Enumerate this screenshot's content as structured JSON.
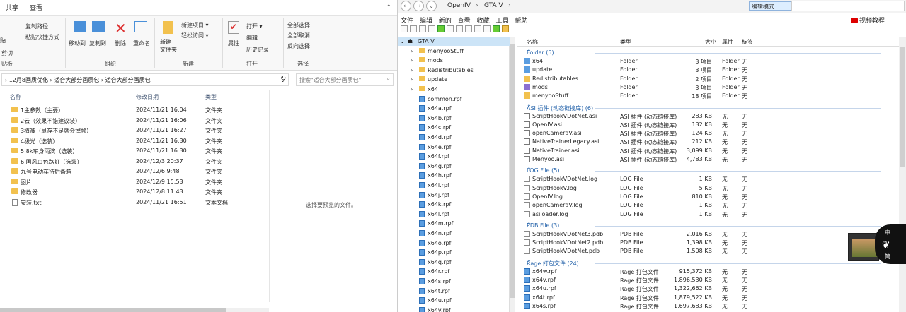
{
  "explorer": {
    "ribbon_tabs": [
      "共享",
      "查看"
    ],
    "ribbon": {
      "paste": "贴",
      "cut": "剪切",
      "copy_path": "复制路径",
      "paste_shortcut": "粘贴快捷方式",
      "clipboard_group": "贴板",
      "move_to": "移动到",
      "copy_to": "复制到",
      "delete": "删除",
      "rename": "重命名",
      "organize_group": "组织",
      "new_folder": "新建\n文件夹",
      "new_item": "新建项目 ▾",
      "easy_access": "轻松访问 ▾",
      "new_group": "新建",
      "properties": "属性",
      "open": "打开 ▾",
      "edit": "编辑",
      "history": "历史记录",
      "open_group": "打开",
      "select_all": "全部选择",
      "select_none": "全部取消",
      "invert": "反向选择",
      "select_group": "选择"
    },
    "address": "›  12月8画质优化  ›  适合大部分画质包  ›  适合大部分画质包",
    "search_placeholder": "搜索\"适合大部分画质包\"",
    "columns": {
      "name": "名称",
      "date": "修改日期",
      "type": "类型"
    },
    "files": [
      {
        "name": "1主参数（主要）",
        "date": "2024/11/21 16:04",
        "type": "文件夹",
        "kind": "folder"
      },
      {
        "name": "2云（效果不错建议装）",
        "date": "2024/11/21 16:06",
        "type": "文件夹",
        "kind": "folder"
      },
      {
        "name": "3植被（显存不足就会掉帧）",
        "date": "2024/11/21 16:27",
        "type": "文件夹",
        "kind": "folder"
      },
      {
        "name": "4极光（选装）",
        "date": "2024/11/21 16:30",
        "type": "文件夹",
        "kind": "folder"
      },
      {
        "name": "5 8k车身雨滴（选装）",
        "date": "2024/11/21 16:30",
        "type": "文件夹",
        "kind": "folder"
      },
      {
        "name": "6 国风白色路灯（选装）",
        "date": "2024/12/3 20:37",
        "type": "文件夹",
        "kind": "folder"
      },
      {
        "name": "九号电动车待后备箱",
        "date": "2024/12/6 9:48",
        "type": "文件夹",
        "kind": "folder"
      },
      {
        "name": "图片",
        "date": "2024/12/9 15:53",
        "type": "文件夹",
        "kind": "folder"
      },
      {
        "name": "修改器",
        "date": "2024/12/8 11:43",
        "type": "文件夹",
        "kind": "folder"
      },
      {
        "name": "安装.txt",
        "date": "2024/11/21 16:51",
        "type": "文本文档",
        "kind": "txt"
      }
    ],
    "preview_message": "选择要预览的文件。"
  },
  "openiv": {
    "path": [
      "OpenIV",
      "GTA V"
    ],
    "edit_mode": "编辑模式",
    "menu": [
      "文件",
      "编辑",
      "新的",
      "查看",
      "收藏",
      "工具",
      "帮助"
    ],
    "video_tutorial": "视频教程",
    "tree": [
      {
        "label": "GTA V",
        "kind": "root",
        "level": 0,
        "selected": true
      },
      {
        "label": "menyooStuff",
        "kind": "folder",
        "level": 1
      },
      {
        "label": "mods",
        "kind": "folder",
        "level": 1
      },
      {
        "label": "Redistributables",
        "kind": "folder",
        "level": 1
      },
      {
        "label": "update",
        "kind": "folder",
        "level": 1
      },
      {
        "label": "x64",
        "kind": "folder",
        "level": 1
      },
      {
        "label": "common.rpf",
        "kind": "file",
        "level": 1
      },
      {
        "label": "x64a.rpf",
        "kind": "file",
        "level": 1
      },
      {
        "label": "x64b.rpf",
        "kind": "file",
        "level": 1
      },
      {
        "label": "x64c.rpf",
        "kind": "file",
        "level": 1
      },
      {
        "label": "x64d.rpf",
        "kind": "file",
        "level": 1
      },
      {
        "label": "x64e.rpf",
        "kind": "file",
        "level": 1
      },
      {
        "label": "x64f.rpf",
        "kind": "file",
        "level": 1
      },
      {
        "label": "x64g.rpf",
        "kind": "file",
        "level": 1
      },
      {
        "label": "x64h.rpf",
        "kind": "file",
        "level": 1
      },
      {
        "label": "x64i.rpf",
        "kind": "file",
        "level": 1
      },
      {
        "label": "x64j.rpf",
        "kind": "file",
        "level": 1
      },
      {
        "label": "x64k.rpf",
        "kind": "file",
        "level": 1
      },
      {
        "label": "x64l.rpf",
        "kind": "file",
        "level": 1
      },
      {
        "label": "x64m.rpf",
        "kind": "file",
        "level": 1
      },
      {
        "label": "x64n.rpf",
        "kind": "file",
        "level": 1
      },
      {
        "label": "x64o.rpf",
        "kind": "file",
        "level": 1
      },
      {
        "label": "x64p.rpf",
        "kind": "file",
        "level": 1
      },
      {
        "label": "x64q.rpf",
        "kind": "file",
        "level": 1
      },
      {
        "label": "x64r.rpf",
        "kind": "file",
        "level": 1
      },
      {
        "label": "x64s.rpf",
        "kind": "file",
        "level": 1
      },
      {
        "label": "x64t.rpf",
        "kind": "file",
        "level": 1
      },
      {
        "label": "x64u.rpf",
        "kind": "file",
        "level": 1
      },
      {
        "label": "x64v.rpf",
        "kind": "file",
        "level": 1
      }
    ],
    "columns": {
      "name": "名称",
      "type": "类型",
      "size": "大小",
      "attr": "属性",
      "tag": "标签"
    },
    "groups": [
      {
        "title": "Folder (5)",
        "icon": "folder",
        "items": [
          {
            "name": "x64",
            "type": "Folder",
            "size": "3 项目",
            "attr": "Folder",
            "tag": "无",
            "icon": "folder-blue"
          },
          {
            "name": "update",
            "type": "Folder",
            "size": "3 项目",
            "attr": "Folder",
            "tag": "无",
            "icon": "folder-blue"
          },
          {
            "name": "Redistributables",
            "type": "Folder",
            "size": "2 项目",
            "attr": "Folder",
            "tag": "无",
            "icon": "folder"
          },
          {
            "name": "mods",
            "type": "Folder",
            "size": "3 项目",
            "attr": "Folder",
            "tag": "无",
            "icon": "folder-purple"
          },
          {
            "name": "menyooStuff",
            "type": "Folder",
            "size": "18 项目",
            "attr": "Folder",
            "tag": "无",
            "icon": "folder"
          }
        ]
      },
      {
        "title": "ASI 插件 (动态链接库) (6)",
        "icon": "asi",
        "items": [
          {
            "name": "ScriptHookVDotNet.asi",
            "type": "ASI 插件 (动态链接库)",
            "size": "283 KB",
            "attr": "无",
            "tag": "无",
            "icon": "asi"
          },
          {
            "name": "OpenIV.asi",
            "type": "ASI 插件 (动态链接库)",
            "size": "132 KB",
            "attr": "无",
            "tag": "无",
            "icon": "asi"
          },
          {
            "name": "openCameraV.asi",
            "type": "ASI 插件 (动态链接库)",
            "size": "124 KB",
            "attr": "无",
            "tag": "无",
            "icon": "asi"
          },
          {
            "name": "NativeTrainerLegacy.asi",
            "type": "ASI 插件 (动态链接库)",
            "size": "212 KB",
            "attr": "无",
            "tag": "无",
            "icon": "asi"
          },
          {
            "name": "NativeTrainer.asi",
            "type": "ASI 插件 (动态链接库)",
            "size": "3,099 KB",
            "attr": "无",
            "tag": "无",
            "icon": "asi"
          },
          {
            "name": "Menyoo.asi",
            "type": "ASI 插件 (动态链接库)",
            "size": "4,783 KB",
            "attr": "无",
            "tag": "无",
            "icon": "asi"
          }
        ]
      },
      {
        "title": "LOG File (5)",
        "icon": "log",
        "items": [
          {
            "name": "ScriptHookVDotNet.log",
            "type": "LOG File",
            "size": "1 KB",
            "attr": "无",
            "tag": "无",
            "icon": "log"
          },
          {
            "name": "ScriptHookV.log",
            "type": "LOG File",
            "size": "5 KB",
            "attr": "无",
            "tag": "无",
            "icon": "log"
          },
          {
            "name": "OpenIV.log",
            "type": "LOG File",
            "size": "810 KB",
            "attr": "无",
            "tag": "无",
            "icon": "log"
          },
          {
            "name": "openCameraV.log",
            "type": "LOG File",
            "size": "1 KB",
            "attr": "无",
            "tag": "无",
            "icon": "log"
          },
          {
            "name": "asiloader.log",
            "type": "LOG File",
            "size": "1 KB",
            "attr": "无",
            "tag": "无",
            "icon": "log"
          }
        ]
      },
      {
        "title": "PDB File (3)",
        "icon": "pdb",
        "items": [
          {
            "name": "ScriptHookVDotNet3.pdb",
            "type": "PDB File",
            "size": "2,016 KB",
            "attr": "无",
            "tag": "无",
            "icon": "pdb"
          },
          {
            "name": "ScriptHookVDotNet2.pdb",
            "type": "PDB File",
            "size": "1,398 KB",
            "attr": "无",
            "tag": "无",
            "icon": "pdb"
          },
          {
            "name": "ScriptHookVDotNet.pdb",
            "type": "PDB File",
            "size": "1,508 KB",
            "attr": "无",
            "tag": "无",
            "icon": "pdb"
          }
        ]
      },
      {
        "title": "Rage 打包文件 (24)",
        "icon": "rpf",
        "items": [
          {
            "name": "x64w.rpf",
            "type": "Rage 打包文件",
            "size": "915,372 KB",
            "attr": "无",
            "tag": "无",
            "icon": "rpf"
          },
          {
            "name": "x64v.rpf",
            "type": "Rage 打包文件",
            "size": "1,896,530 KB",
            "attr": "无",
            "tag": "无",
            "icon": "rpf"
          },
          {
            "name": "x64u.rpf",
            "type": "Rage 打包文件",
            "size": "1,322,662 KB",
            "attr": "无",
            "tag": "无",
            "icon": "rpf"
          },
          {
            "name": "x64t.rpf",
            "type": "Rage 打包文件",
            "size": "1,879,522 KB",
            "attr": "无",
            "tag": "无",
            "icon": "rpf"
          },
          {
            "name": "x64s.rpf",
            "type": "Rage 打包文件",
            "size": "1,697,683 KB",
            "attr": "无",
            "tag": "无",
            "icon": "rpf"
          }
        ]
      }
    ]
  },
  "overlay": {
    "top": "中",
    "bottom": "简"
  }
}
